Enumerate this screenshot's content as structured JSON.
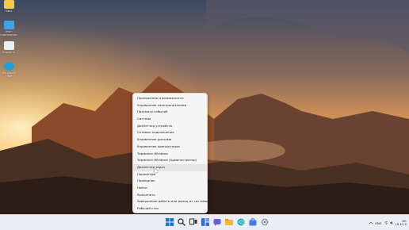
{
  "desktop": {
    "icons": [
      {
        "name": "folder-icon",
        "label": "User",
        "color": "#f3c94b"
      },
      {
        "name": "computer-icon",
        "label": "Этот компьютер",
        "color": "#3aa6e8"
      },
      {
        "name": "recycle-bin-icon",
        "label": "Корзина",
        "color": "#e8eef6"
      },
      {
        "name": "edge-icon",
        "label": "Microsoft Edge",
        "color": "#1fa0d8"
      }
    ]
  },
  "context_menu": {
    "items": [
      {
        "label": "Приложения и возможности"
      },
      {
        "label": "Управление электропитанием"
      },
      {
        "label": "Просмотр событий"
      },
      {
        "label": "Система"
      },
      {
        "label": "Диспетчер устройств"
      },
      {
        "label": "Сетевые подключения"
      },
      {
        "label": "Управление дисками"
      },
      {
        "label": "Управление компьютером"
      },
      {
        "label": "Терминал Windows"
      },
      {
        "label": "Терминал Windows (Администратор)"
      },
      {
        "label": "Диспетчер задач"
      },
      {
        "label": "Параметры"
      },
      {
        "label": "Проводник"
      },
      {
        "label": "Найти"
      },
      {
        "label": "Выполнить"
      },
      {
        "label": "Завершение работы или выход из системы",
        "arrow": "›"
      },
      {
        "label": "Рабочий стол"
      }
    ],
    "hovered_index": 10
  },
  "taskbar": {
    "icons": [
      {
        "name": "start-icon",
        "color": "#1a73d9"
      },
      {
        "name": "search-icon",
        "color": "#222222"
      },
      {
        "name": "task-view-icon",
        "color": "#333333"
      },
      {
        "name": "widgets-icon",
        "color": "#2f6fd1"
      },
      {
        "name": "chat-icon",
        "color": "#6b5ce0"
      },
      {
        "name": "file-explorer-icon",
        "color": "#f0b53c"
      },
      {
        "name": "edge-icon",
        "color": "#1fa0d8"
      },
      {
        "name": "store-icon",
        "color": "#3f7fdd"
      },
      {
        "name": "settings-icon",
        "color": "#6b7280"
      }
    ],
    "tray": {
      "lang": "ENG",
      "time": "16:",
      "date": "19.12.2"
    }
  }
}
